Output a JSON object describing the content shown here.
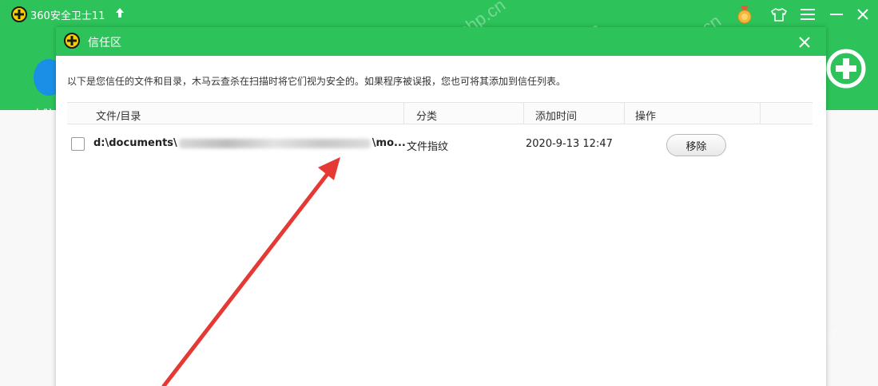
{
  "app": {
    "title": "360安全卫士11",
    "pc_label": "电脑"
  },
  "dialog": {
    "title": "信任区",
    "description": "以下是您信任的文件和目录，木马云查杀在扫描时将它们视为安全的。如果程序被误报，您也可将其添加到信任列表。",
    "columns": [
      "文件/目录",
      "分类",
      "添加时间",
      "操作"
    ],
    "rows": [
      {
        "path_start": "d:\\documents\\",
        "path_end": "\\mo...",
        "category": "文件指纹",
        "time": "2020-9-13 12:47",
        "action": "移除"
      }
    ]
  },
  "watermark": "php.cn",
  "colors": {
    "brand_green": "#2dc35a",
    "arrow_red": "#e53935"
  }
}
